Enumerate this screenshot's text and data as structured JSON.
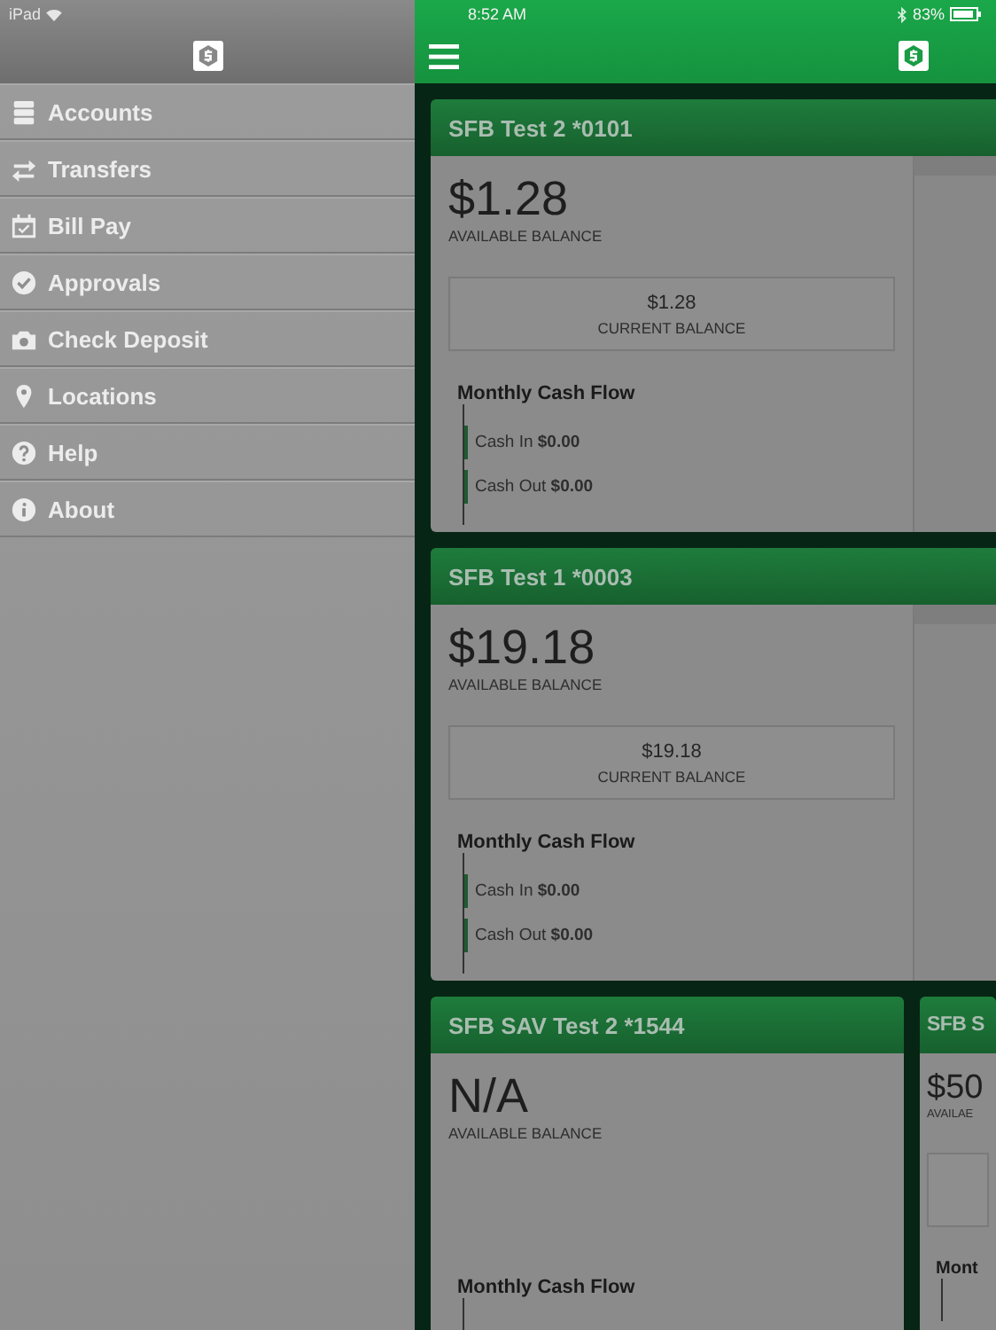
{
  "status_bar": {
    "carrier": "iPad",
    "time": "8:52 AM",
    "battery": "83%"
  },
  "menu": {
    "items": [
      {
        "label": "Accounts"
      },
      {
        "label": "Transfers"
      },
      {
        "label": "Bill Pay"
      },
      {
        "label": "Approvals"
      },
      {
        "label": "Check Deposit"
      },
      {
        "label": "Locations"
      },
      {
        "label": "Help"
      },
      {
        "label": "About"
      }
    ]
  },
  "account_rows": [
    {
      "cards": [
        {
          "kind": "wide",
          "name": "SFB Test 2 *0101",
          "available": "$1.28",
          "available_label": "AVAILABLE BALANCE",
          "current": "$1.28",
          "current_label": "CURRENT BALANCE",
          "cashflow_title": "Monthly Cash Flow",
          "cash_in_label": "Cash In",
          "cash_in": "$0.00",
          "cash_out_label": "Cash Out",
          "cash_out": "$0.00"
        }
      ]
    },
    {
      "cards": [
        {
          "kind": "wide",
          "name": "SFB Test 1 *0003",
          "available": "$19.18",
          "available_label": "AVAILABLE BALANCE",
          "current": "$19.18",
          "current_label": "CURRENT BALANCE",
          "cashflow_title": "Monthly Cash Flow",
          "cash_in_label": "Cash In",
          "cash_in": "$0.00",
          "cash_out_label": "Cash Out",
          "cash_out": "$0.00"
        }
      ]
    },
    {
      "cards": [
        {
          "kind": "narrow",
          "name": "SFB SAV Test 2 *1544",
          "available": "N/A",
          "available_label": "AVAILABLE BALANCE",
          "cashflow_title": "Monthly Cash Flow"
        },
        {
          "kind": "partial",
          "name": "SFB S",
          "available": "$50",
          "available_label": "AVAILAE",
          "current_box": true,
          "cashflow_title": "Mont"
        }
      ]
    }
  ]
}
